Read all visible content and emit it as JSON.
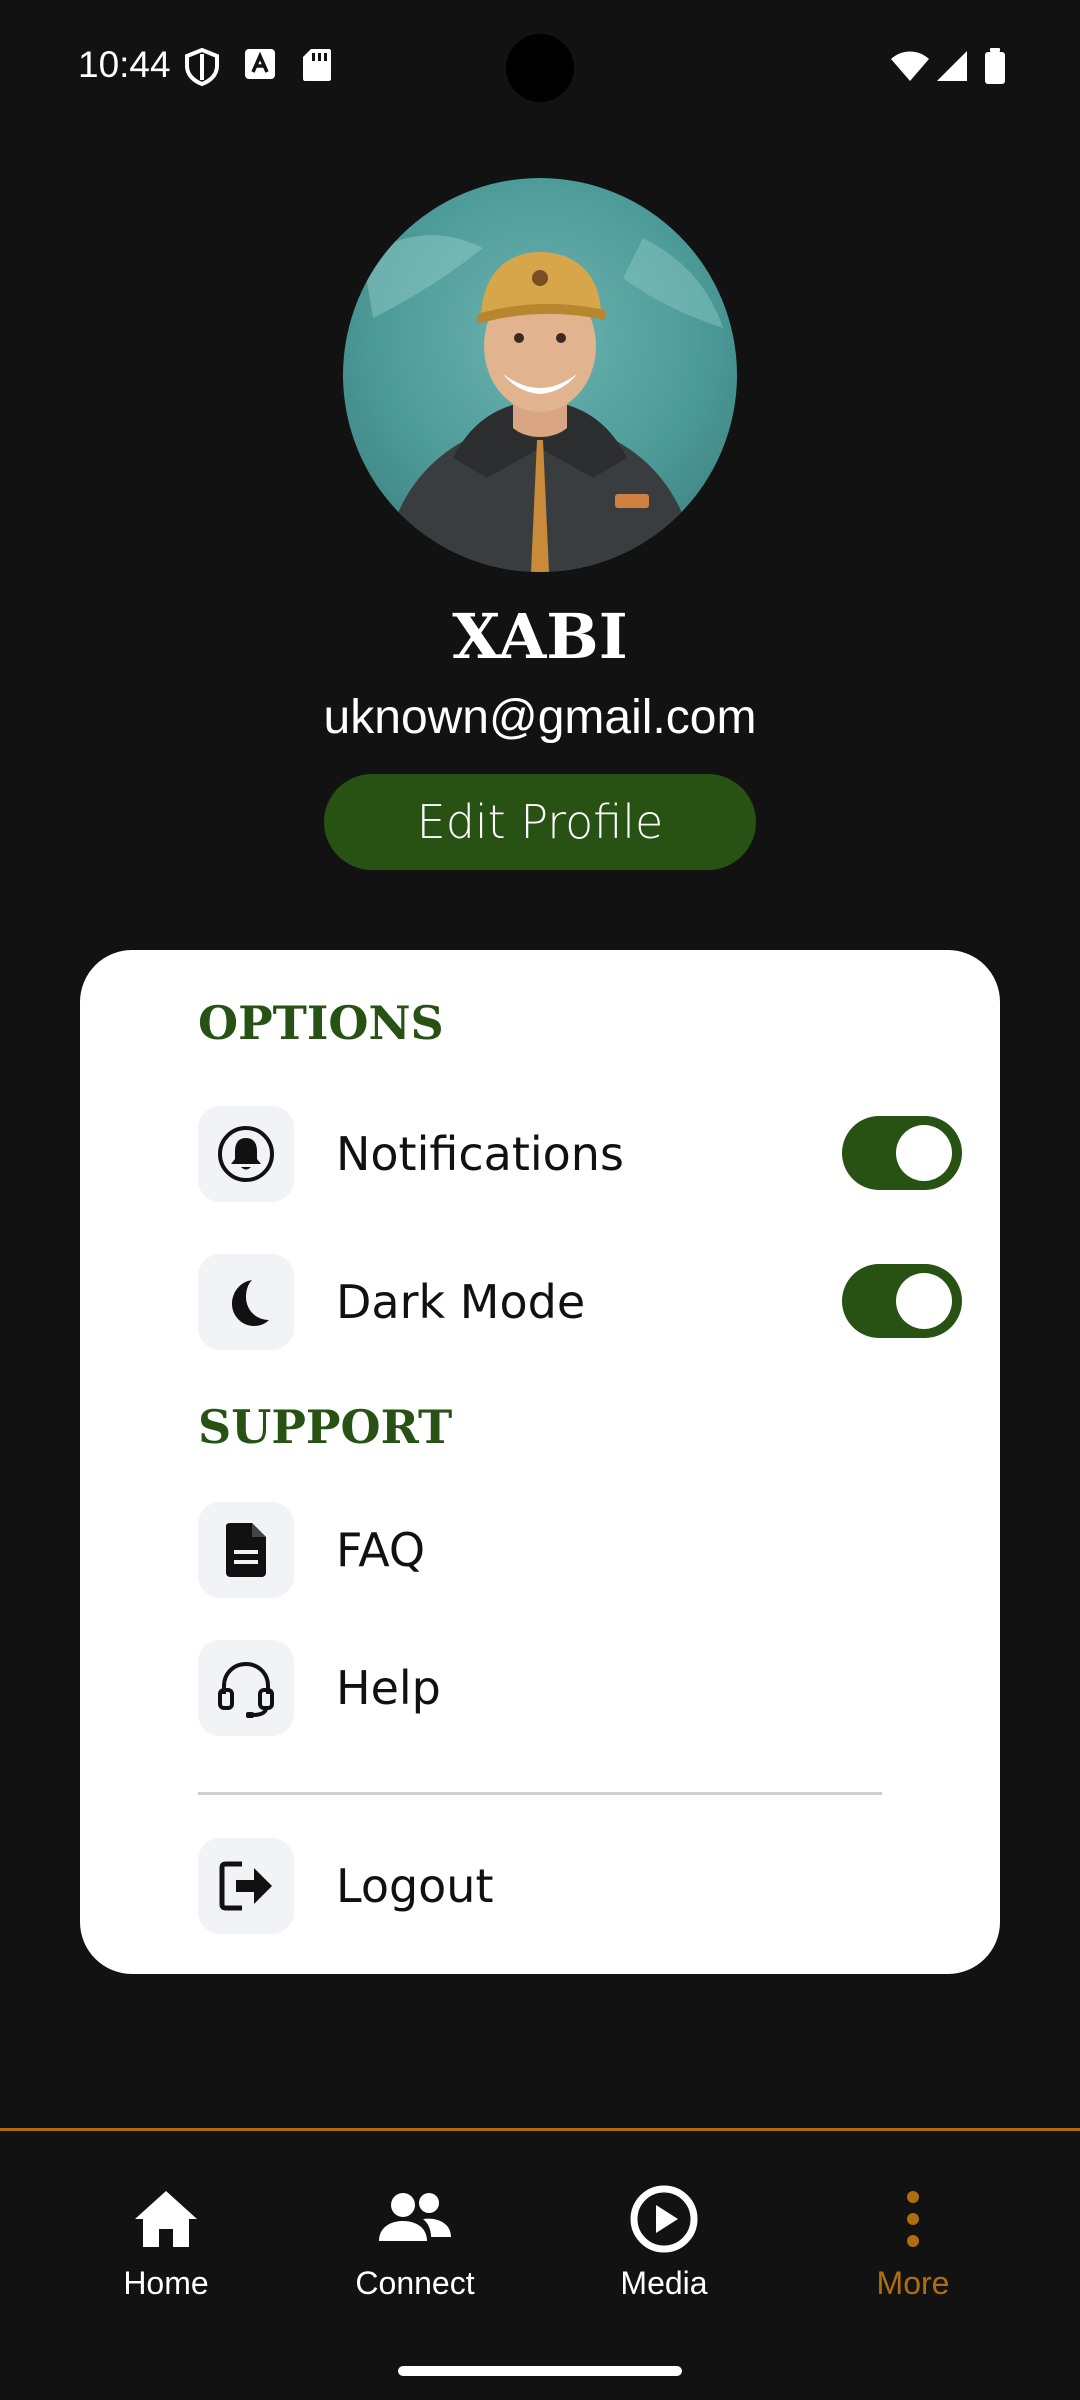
{
  "status_bar": {
    "time": "10:44"
  },
  "profile": {
    "name": "XABI",
    "email": "uknown@gmail.com",
    "edit_label": "Edit Profile"
  },
  "options": {
    "title": "OPTIONS",
    "notifications_label": "Notifications",
    "notifications_on": true,
    "dark_mode_label": "Dark Mode",
    "dark_mode_on": true
  },
  "support": {
    "title": "SUPPORT",
    "faq_label": "FAQ",
    "help_label": "Help"
  },
  "logout_label": "Logout",
  "nav": {
    "home": "Home",
    "connect": "Connect",
    "media": "Media",
    "more": "More",
    "active": "more"
  },
  "colors": {
    "accent_green": "#275214",
    "accent_orange": "#b06d10",
    "background": "#121212"
  },
  "icons": {
    "notifications": "bell-icon",
    "dark_mode": "moon-icon",
    "faq": "document-icon",
    "help": "headset-icon",
    "logout": "logout-icon",
    "home": "home-icon",
    "connect": "people-icon",
    "media": "play-circle-icon",
    "more": "more-vertical-icon"
  }
}
